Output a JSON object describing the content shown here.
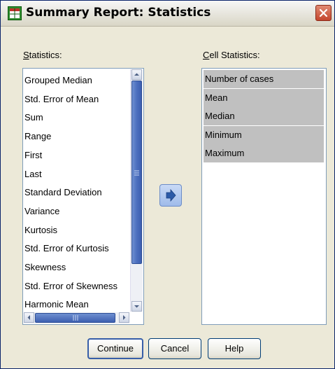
{
  "window": {
    "title": "Summary Report: Statistics"
  },
  "statistics": {
    "label_accel": "S",
    "label_rest": "tatistics:",
    "items": [
      "Grouped Median",
      "Std. Error of Mean",
      "Sum",
      "Range",
      "First",
      "Last",
      "Standard Deviation",
      "Variance",
      "Kurtosis",
      "Std. Error of Kurtosis",
      "Skewness",
      "Std. Error of Skewness",
      "Harmonic Mean"
    ]
  },
  "cell_statistics": {
    "label_accel": "C",
    "label_rest": "ell Statistics:",
    "items": [
      "Number of cases",
      "Mean",
      "Median",
      "Minimum",
      "Maximum"
    ]
  },
  "buttons": {
    "continue": "Continue",
    "cancel": "Cancel",
    "help": "Help"
  },
  "colors": {
    "dialog_bg": "#ece9d8",
    "selected_bg": "#c0c0c0",
    "list_border": "#7f9db9"
  },
  "icons": {
    "app": "spss-table-icon",
    "close": "close-icon",
    "move": "arrow-right-icon"
  }
}
